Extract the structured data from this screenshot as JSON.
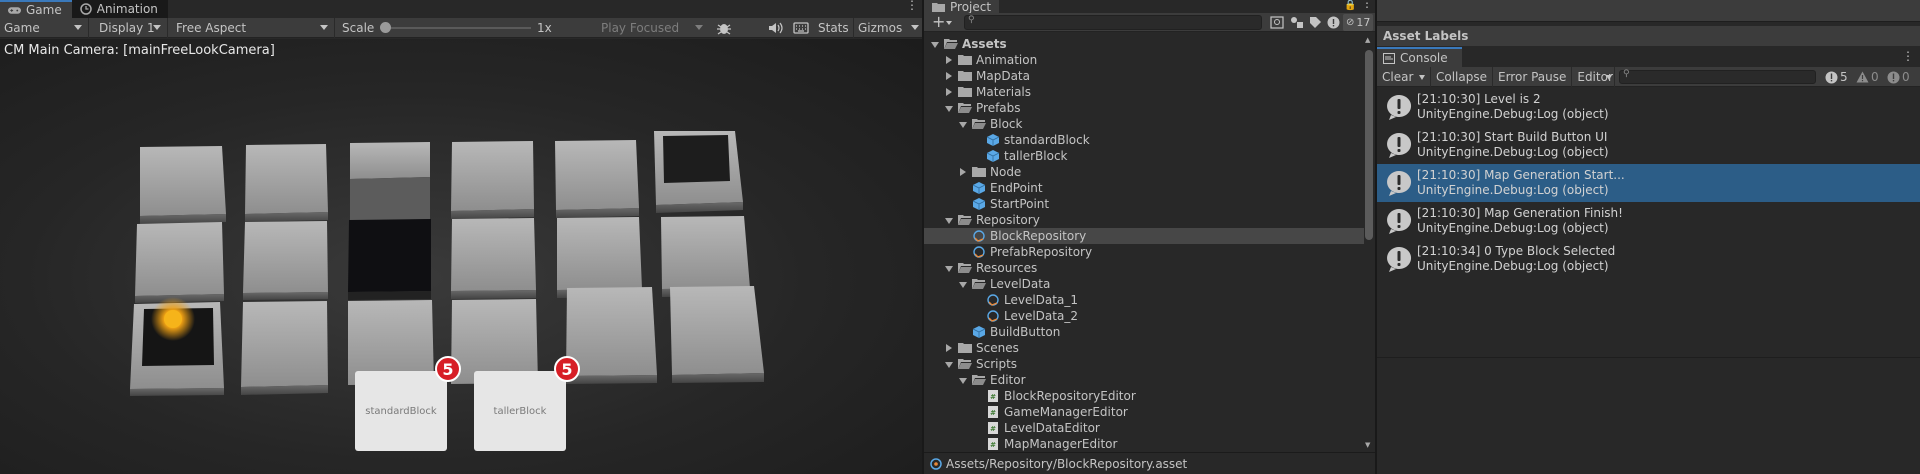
{
  "game": {
    "tabs": [
      {
        "label": "Game",
        "icon": "gamepad-icon"
      },
      {
        "label": "Animation",
        "icon": "animation-clock-icon"
      }
    ],
    "toolbar": {
      "view_mode": "Game",
      "display": "Display 1",
      "aspect": "Free Aspect",
      "scale_label": "Scale",
      "scale_value": "1x",
      "scale_fraction": 0.0,
      "play_mode": "Play Focused",
      "stats": "Stats",
      "gizmos": "Gizmos"
    },
    "camera_label": "CM Main Camera: [mainFreeLookCamera]",
    "ui_cards": [
      {
        "label": "standardBlock",
        "count": "5"
      },
      {
        "label": "tallerBlock",
        "count": "5"
      }
    ]
  },
  "project": {
    "tab": "Project",
    "hidden_count": "17",
    "tree": [
      {
        "label": "Assets",
        "icon": "folder-open-icon",
        "depth": 0,
        "arrow": "down",
        "bold": true
      },
      {
        "label": "Animation",
        "icon": "folder-icon",
        "depth": 1,
        "arrow": "right"
      },
      {
        "label": "MapData",
        "icon": "folder-icon",
        "depth": 1,
        "arrow": "right"
      },
      {
        "label": "Materials",
        "icon": "folder-icon",
        "depth": 1,
        "arrow": "right"
      },
      {
        "label": "Prefabs",
        "icon": "folder-open-icon",
        "depth": 1,
        "arrow": "down"
      },
      {
        "label": "Block",
        "icon": "folder-open-icon",
        "depth": 2,
        "arrow": "down"
      },
      {
        "label": "standardBlock",
        "icon": "prefab-cube-icon",
        "depth": 3,
        "arrow": "none"
      },
      {
        "label": "tallerBlock",
        "icon": "prefab-cube-icon",
        "depth": 3,
        "arrow": "none"
      },
      {
        "label": "Node",
        "icon": "folder-icon",
        "depth": 2,
        "arrow": "right"
      },
      {
        "label": "EndPoint",
        "icon": "prefab-cube-icon",
        "depth": 2,
        "arrow": "none"
      },
      {
        "label": "StartPoint",
        "icon": "prefab-cube-icon",
        "depth": 2,
        "arrow": "none"
      },
      {
        "label": "Repository",
        "icon": "folder-open-icon",
        "depth": 1,
        "arrow": "down"
      },
      {
        "label": "BlockRepository",
        "icon": "scriptable-object-icon",
        "depth": 2,
        "arrow": "none",
        "selected": true
      },
      {
        "label": "PrefabRepository",
        "icon": "scriptable-object-icon",
        "depth": 2,
        "arrow": "none"
      },
      {
        "label": "Resources",
        "icon": "folder-open-icon",
        "depth": 1,
        "arrow": "down"
      },
      {
        "label": "LevelData",
        "icon": "folder-open-icon",
        "depth": 2,
        "arrow": "down"
      },
      {
        "label": "LevelData_1",
        "icon": "scriptable-object-icon",
        "depth": 3,
        "arrow": "none"
      },
      {
        "label": "LevelData_2",
        "icon": "scriptable-object-icon",
        "depth": 3,
        "arrow": "none"
      },
      {
        "label": "BuildButton",
        "icon": "prefab-cube-icon",
        "depth": 2,
        "arrow": "none"
      },
      {
        "label": "Scenes",
        "icon": "folder-icon",
        "depth": 1,
        "arrow": "right"
      },
      {
        "label": "Scripts",
        "icon": "folder-open-icon",
        "depth": 1,
        "arrow": "down"
      },
      {
        "label": "Editor",
        "icon": "folder-open-icon",
        "depth": 2,
        "arrow": "down"
      },
      {
        "label": "BlockRepositoryEditor",
        "icon": "csharp-script-icon",
        "depth": 3,
        "arrow": "none"
      },
      {
        "label": "GameManagerEditor",
        "icon": "csharp-script-icon",
        "depth": 3,
        "arrow": "none"
      },
      {
        "label": "LevelDataEditor",
        "icon": "csharp-script-icon",
        "depth": 3,
        "arrow": "none"
      },
      {
        "label": "MapManagerEditor",
        "icon": "csharp-script-icon",
        "depth": 3,
        "arrow": "none"
      }
    ],
    "status_path": "Assets/Repository/BlockRepository.asset"
  },
  "asset_labels": "Asset Labels",
  "console": {
    "tab": "Console",
    "clear": "Clear",
    "collapse": "Collapse",
    "error_pause": "Error Pause",
    "editor": "Editor",
    "log_count": "5",
    "warn_count": "0",
    "error_count": "0",
    "entries": [
      {
        "line1": "[21:10:30] Level is 2",
        "line2": "UnityEngine.Debug:Log (object)"
      },
      {
        "line1": "[21:10:30] Start Build Button UI",
        "line2": "UnityEngine.Debug:Log (object)"
      },
      {
        "line1": "[21:10:30] Map Generation Start...",
        "line2": "UnityEngine.Debug:Log (object)",
        "selected": true
      },
      {
        "line1": "[21:10:30] Map Generation Finish!",
        "line2": "UnityEngine.Debug:Log (object)"
      },
      {
        "line1": "[21:10:34] 0 Type Block Selected",
        "line2": "UnityEngine.Debug:Log (object)"
      }
    ]
  },
  "colors": {
    "accent": "#3a79bb",
    "selection": "#2c5d87",
    "badge": "#d71e26",
    "folder": "#a8a8a8",
    "prefab": "#5aa8e6"
  }
}
